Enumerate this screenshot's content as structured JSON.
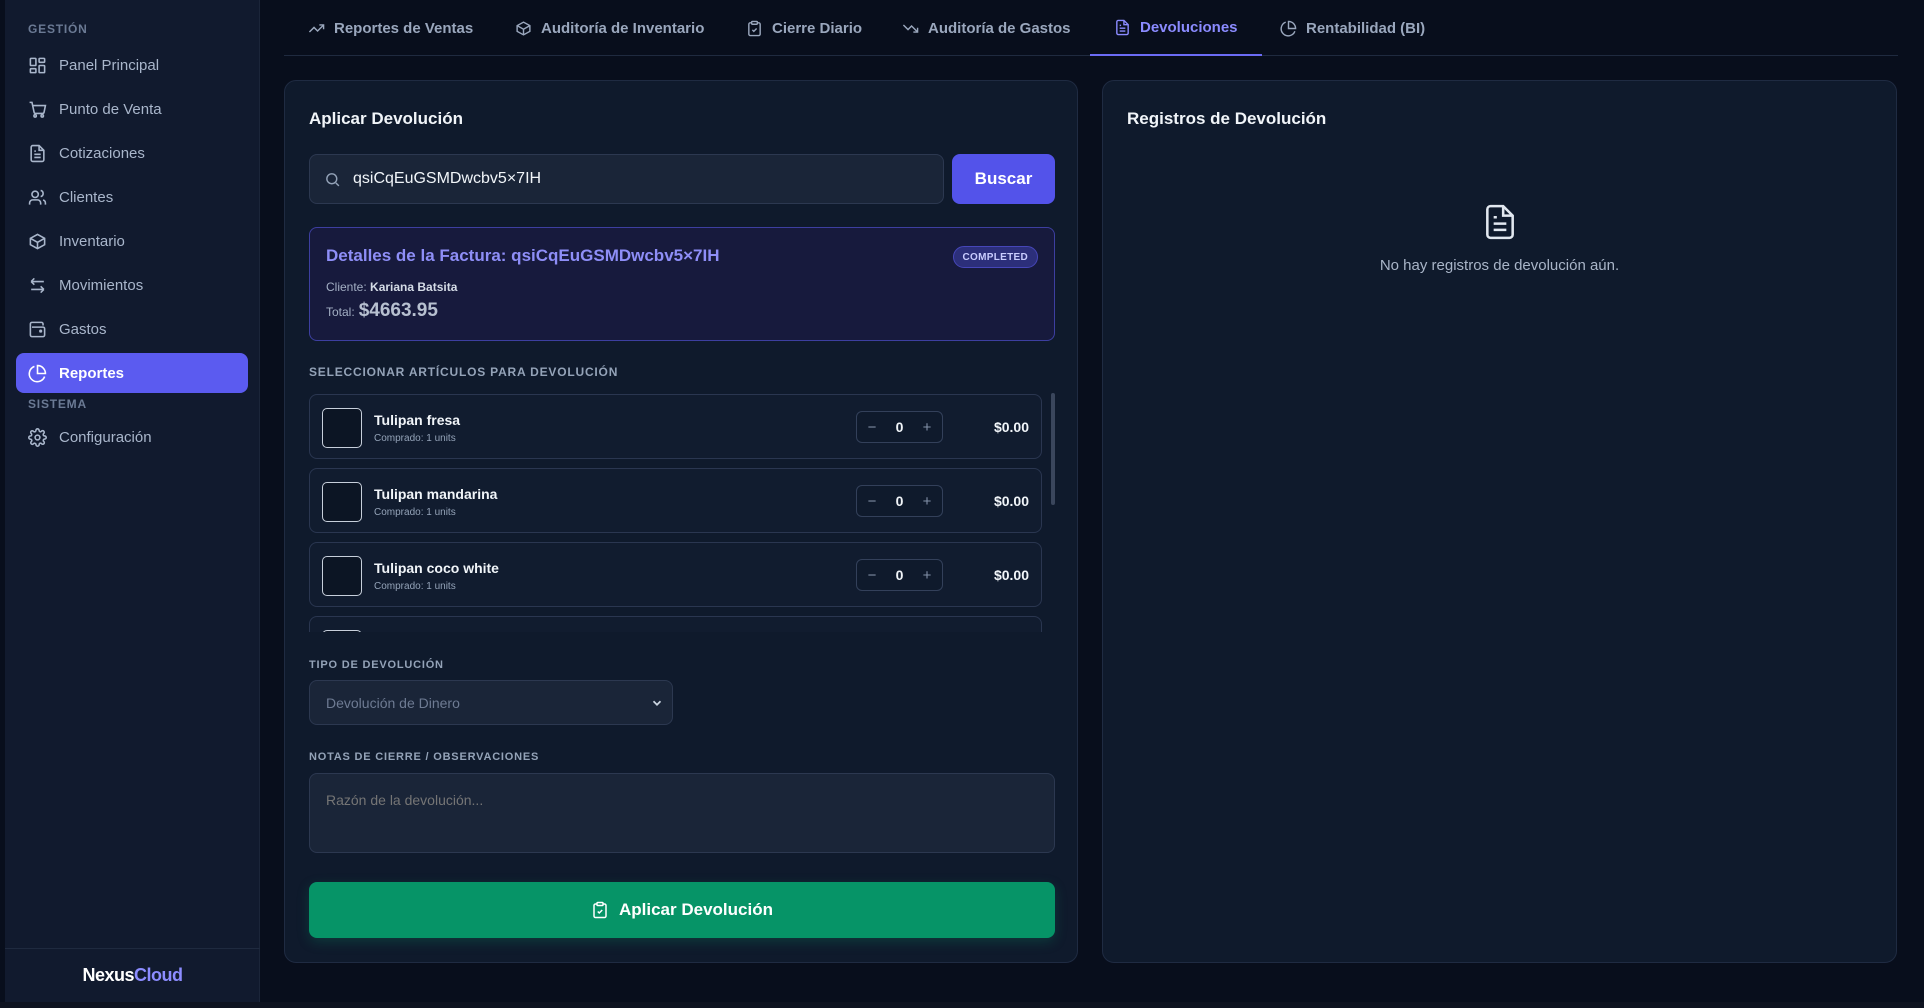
{
  "sidebar": {
    "section_gestion": "GESTIÓN",
    "section_sistema": "SISTEMA",
    "items": [
      {
        "label": "Panel Principal",
        "icon": "dashboard-icon"
      },
      {
        "label": "Punto de Venta",
        "icon": "cart-icon"
      },
      {
        "label": "Cotizaciones",
        "icon": "document-icon"
      },
      {
        "label": "Clientes",
        "icon": "users-icon"
      },
      {
        "label": "Inventario",
        "icon": "box-icon"
      },
      {
        "label": "Movimientos",
        "icon": "arrows-icon"
      },
      {
        "label": "Gastos",
        "icon": "wallet-icon"
      },
      {
        "label": "Reportes",
        "icon": "pie-chart-icon",
        "active": true
      }
    ],
    "system_items": [
      {
        "label": "Configuración",
        "icon": "gear-icon"
      }
    ],
    "brand": {
      "part1": "Nexus",
      "part2": "Cloud"
    }
  },
  "tabs": [
    {
      "label": "Reportes de Ventas",
      "icon": "trending-up-icon"
    },
    {
      "label": "Auditoría de Inventario",
      "icon": "box-icon"
    },
    {
      "label": "Cierre Diario",
      "icon": "clipboard-icon"
    },
    {
      "label": "Auditoría de Gastos",
      "icon": "trending-down-icon"
    },
    {
      "label": "Devoluciones",
      "icon": "document-icon",
      "active": true
    },
    {
      "label": "Rentabilidad (BI)",
      "icon": "pie-chart-icon"
    }
  ],
  "apply": {
    "title": "Aplicar Devolución",
    "search_value": "qsiCqEuGSMDwcbv5×7IH",
    "search_button": "Buscar",
    "invoice": {
      "title": "Detalles de la Factura: qsiCqEuGSMDwcbv5×7IH",
      "status": "COMPLETED",
      "client_label": "Cliente:",
      "client_name": "Kariana Batsita",
      "total_label": "Total:",
      "total_value": "$4663.95"
    },
    "items_label": "SELECCIONAR ARTÍCULOS PARA DEVOLUCIÓN",
    "items": [
      {
        "name": "Tulipan fresa",
        "purchased": "Comprado: 1 units",
        "qty": "0",
        "price": "$0.00"
      },
      {
        "name": "Tulipan mandarina",
        "purchased": "Comprado: 1 units",
        "qty": "0",
        "price": "$0.00"
      },
      {
        "name": "Tulipan coco white",
        "purchased": "Comprado: 1 units",
        "qty": "0",
        "price": "$0.00"
      }
    ],
    "type_label": "TIPO DE DEVOLUCIÓN",
    "type_value": "Devolución de Dinero",
    "notes_label": "NOTAS DE CIERRE / OBSERVACIONES",
    "notes_placeholder": "Razón de la devolución...",
    "apply_button": "Aplicar Devolución"
  },
  "records": {
    "title": "Registros de Devolución",
    "empty_message": "No hay registros de devolución aún."
  },
  "colors": {
    "accent": "#5b5bf0",
    "success": "#069467",
    "background": "#080e1c",
    "panel": "#0f1a2c"
  }
}
